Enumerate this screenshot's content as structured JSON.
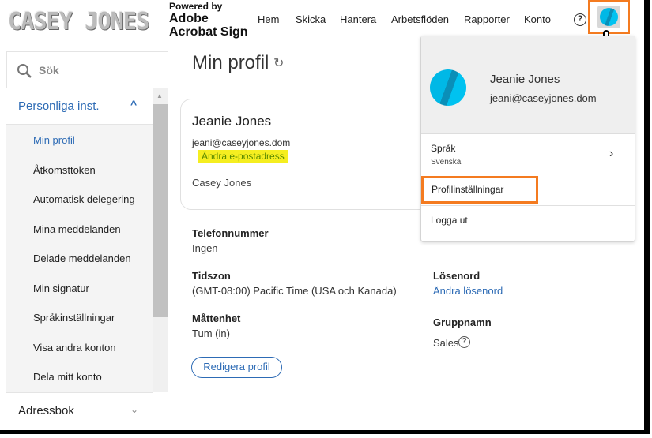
{
  "header": {
    "logo": "CASEY JONES",
    "powered_by": "Powered by",
    "product_line1": "Adobe",
    "product_line2": "Acrobat Sign",
    "nav": [
      "Hem",
      "Skicka",
      "Hantera",
      "Arbetsflöden",
      "Rapporter",
      "Konto"
    ],
    "help": "?"
  },
  "sidebar": {
    "search_placeholder": "Sök",
    "section": "Personliga inst.",
    "items": [
      "Min profil",
      "Åtkomsttoken",
      "Automatisk delegering",
      "Mina meddelanden",
      "Delade meddelanden",
      "Min signatur",
      "Språkinställningar",
      "Visa andra konton",
      "Dela mitt konto"
    ],
    "addressbook": "Adressbok"
  },
  "main": {
    "title": "Min profil",
    "name": "Jeanie Jones",
    "email": "jeani@caseyjones.dom",
    "change_email": "Ändra e-postadress",
    "company": "Casey Jones",
    "phone_label": "Telefonnummer",
    "phone": "Ingen",
    "tz_label": "Tidszon",
    "tz": "(GMT-08:00) Pacific Time (USA och Kanada)",
    "unit_label": "Måttenhet",
    "unit": "Tum (in)",
    "password_label": "Lösenord",
    "change_password": "Ändra lösenord",
    "group_label": "Gruppnamn",
    "group": "Sales",
    "edit": "Redigera profil"
  },
  "menu": {
    "name": "Jeanie Jones",
    "email": "jeani@caseyjones.dom",
    "language_label": "Språk",
    "language": "Svenska",
    "profile_settings": "Profilinställningar",
    "logout": "Logga ut"
  },
  "colors": {
    "accent": "#2d6bb5",
    "highlight": "#f47b20",
    "avatar": "#00b8e6"
  }
}
